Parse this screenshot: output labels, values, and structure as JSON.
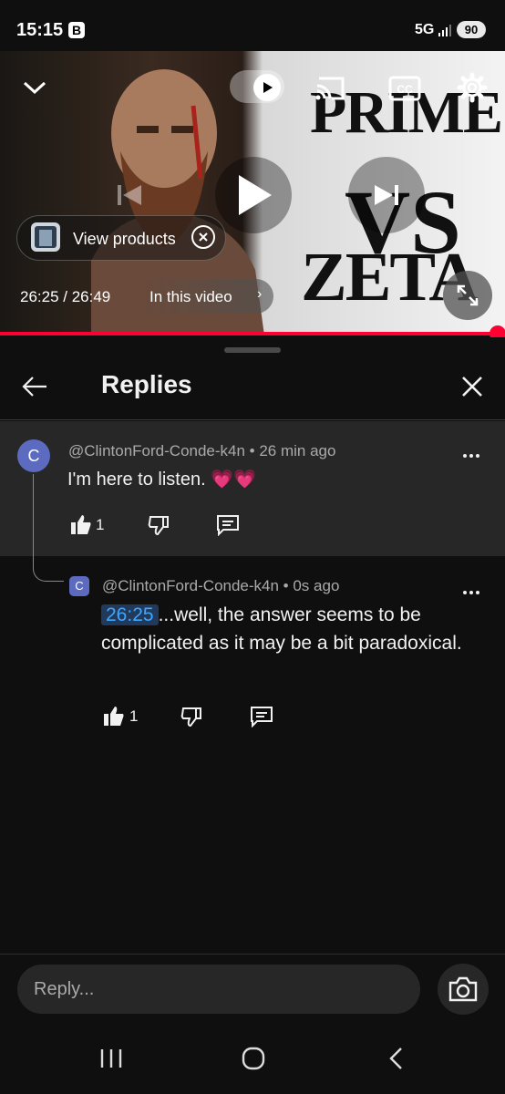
{
  "status_bar": {
    "time": "15:15",
    "badge": "B",
    "network": "5G",
    "battery": "90"
  },
  "video": {
    "thumbnail_text": [
      "PRIME",
      "VS",
      "ZETA"
    ],
    "current_time": "26:25",
    "duration": "26:49",
    "time_display": "26:25 / 26:49",
    "progress_fraction": 0.985,
    "view_products_label": "View products",
    "chapter_label": "In this video",
    "accent_color": "#ff0033",
    "icons": [
      "chevron-down-icon",
      "autoplay-icon",
      "cast-icon",
      "cc-icon",
      "settings-icon",
      "previous-icon",
      "play-icon",
      "next-icon",
      "close-icon",
      "chevron-right-icon",
      "fullscreen-icon"
    ]
  },
  "panel": {
    "title": "Replies"
  },
  "parent_comment": {
    "avatar_letter": "C",
    "meta": "@ClintonFord-Conde-k4n • 26 min ago",
    "text": "I'm here to listen. ",
    "emoji": "💗💗",
    "like_count": "1"
  },
  "reply_comment": {
    "avatar_letter": "C",
    "meta": "@ClintonFord-Conde-k4n • 0s ago",
    "timestamp_link": "26:25",
    "text": "...well, the answer seems to be complicated as it may be a bit paradoxical.",
    "like_count": "1"
  },
  "composer": {
    "placeholder": "Reply...",
    "value": ""
  }
}
